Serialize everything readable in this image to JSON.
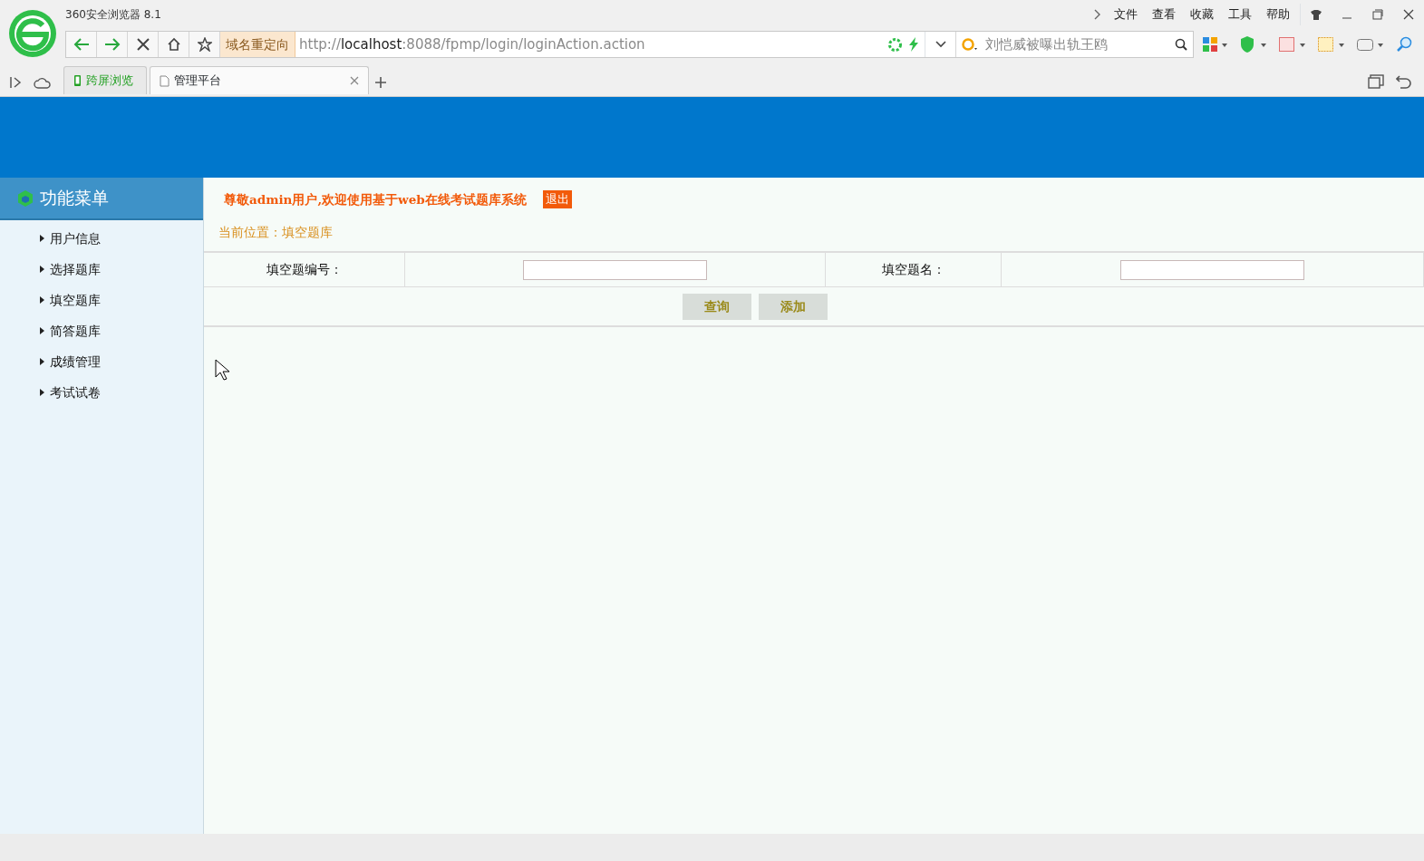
{
  "window": {
    "title": "360安全浏览器 8.1"
  },
  "menu": [
    "文件",
    "查看",
    "收藏",
    "工具",
    "帮助"
  ],
  "toolbar": {
    "redirect_label": "域名重定向",
    "url_parts": [
      {
        "text": "http://",
        "dark": false
      },
      {
        "text": "localhost",
        "dark": true
      },
      {
        "text": ":8088/fpmp/login/loginAction.action",
        "dark": false
      }
    ],
    "search": {
      "placeholder": "刘恺威被曝出轨王鸥"
    }
  },
  "tabs": [
    {
      "label": "跨屏浏览",
      "kind": "screen",
      "selected": false
    },
    {
      "label": "管理平台",
      "kind": "page",
      "selected": true
    }
  ],
  "sidebar": {
    "title": "功能菜单",
    "items": [
      "用户信息",
      "选择题库",
      "填空题库",
      "简答题库",
      "成绩管理",
      "考试试卷"
    ]
  },
  "welcome": {
    "text": "尊敬admin用户,欢迎使用基于web在线考试题库系统",
    "logout": "退出"
  },
  "breadcrumb": "当前位置：填空题库",
  "form": {
    "fields": [
      {
        "label": "填空题编号："
      },
      {
        "label": "填空题名："
      }
    ],
    "buttons": [
      "查询",
      "添加"
    ]
  }
}
